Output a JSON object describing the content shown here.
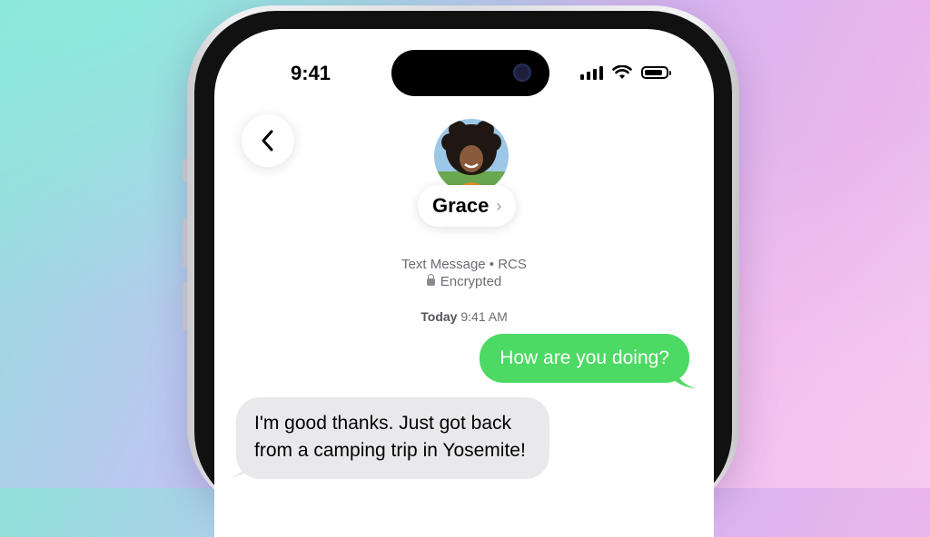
{
  "status_bar": {
    "time": "9:41",
    "battery_level": 0.85
  },
  "conversation": {
    "contact_name": "Grace",
    "service_label": "Text Message • RCS",
    "encryption_label": "Encrypted",
    "timestamp_day": "Today",
    "timestamp_time": "9:41 AM"
  },
  "messages": [
    {
      "direction": "outgoing",
      "text": "How are you doing?"
    },
    {
      "direction": "incoming",
      "line1": "I'm good thanks. Just got back",
      "line2": "from a camping trip in Yosemite!"
    }
  ],
  "colors": {
    "outgoing_bubble": "#4cd964",
    "incoming_bubble": "#e9e9eb",
    "background_gradient": [
      "#8fe0d9",
      "#d8b4ef",
      "#f0c8ef"
    ]
  },
  "icons": [
    "signal-icon",
    "wifi-icon",
    "battery-icon",
    "back-chevron-icon",
    "lock-icon",
    "chevron-right-icon"
  ]
}
